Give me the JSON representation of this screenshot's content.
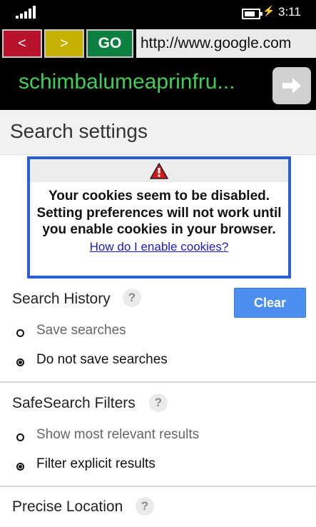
{
  "status_bar": {
    "time": "3:11"
  },
  "nav": {
    "back_label": "<",
    "forward_label": ">",
    "go_label": "GO",
    "url": "http://www.google.com"
  },
  "search": {
    "query": "schimbalumeaprinfru..."
  },
  "page": {
    "title": "Search settings"
  },
  "cookie_warning": {
    "message": "Your cookies seem to be disabled. Setting preferences will not work until you enable cookies in your browser.",
    "link": "How do I enable cookies?"
  },
  "search_history": {
    "title": "Search History",
    "help": "?",
    "clear_label": "Clear",
    "options": [
      "Save searches",
      "Do not save searches"
    ],
    "selected": 1
  },
  "safesearch": {
    "title": "SafeSearch Filters",
    "help": "?",
    "options": [
      "Show most relevant results",
      "Filter explicit results"
    ],
    "selected": 1
  },
  "location": {
    "title": "Precise Location",
    "help": "?"
  },
  "colors": {
    "accent": "#4d8ff0",
    "query": "#3fcf57",
    "warning_border": "#2a5fd3"
  }
}
